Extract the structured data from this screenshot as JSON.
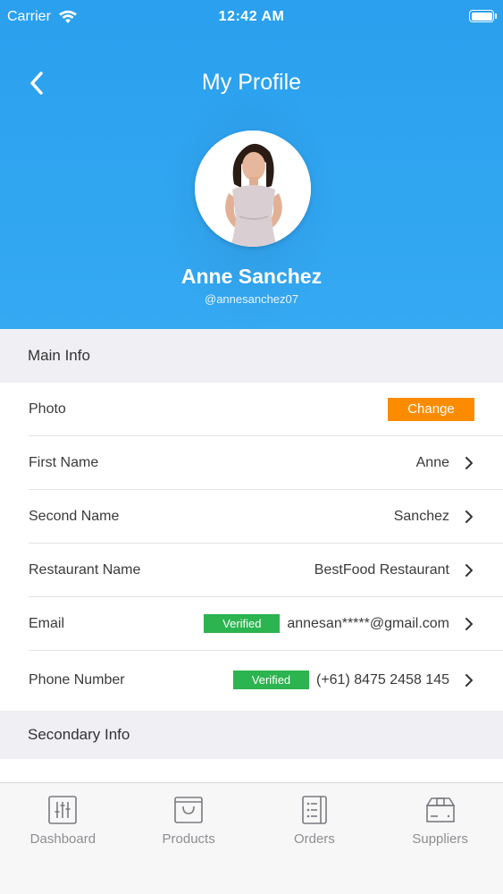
{
  "status_bar": {
    "carrier": "Carrier",
    "time": "12:42 AM"
  },
  "header": {
    "title": "My Profile",
    "name": "Anne Sanchez",
    "handle": "@annesanchez07"
  },
  "main_info": {
    "title": "Main Info",
    "rows": [
      {
        "label": "Photo",
        "action": "Change"
      },
      {
        "label": "First Name",
        "value": "Anne"
      },
      {
        "label": "Second Name",
        "value": "Sanchez"
      },
      {
        "label": "Restaurant Name",
        "value": "BestFood Restaurant"
      },
      {
        "label": "Email",
        "badge": "Verified",
        "value": "annesan*****@gmail.com"
      },
      {
        "label": "Phone Number",
        "badge": "Verified",
        "value": "(+61) 8475 2458 145"
      }
    ]
  },
  "secondary_info": {
    "title": "Secondary Info"
  },
  "tabs": [
    {
      "label": "Dashboard",
      "icon": "sliders-icon"
    },
    {
      "label": "Products",
      "icon": "shopping-bag-icon"
    },
    {
      "label": "Orders",
      "icon": "list-icon"
    },
    {
      "label": "Suppliers",
      "icon": "box-icon"
    }
  ],
  "colors": {
    "header_blue": "#2aa0ee",
    "change_orange": "#fb8c00",
    "verified_green": "#2bb44f",
    "section_gray": "#efeff4"
  }
}
